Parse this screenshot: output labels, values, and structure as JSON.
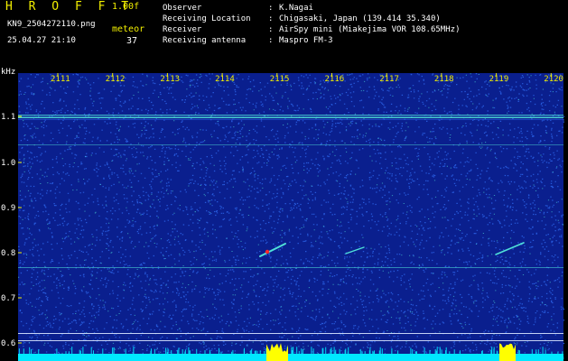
{
  "header": {
    "app_title": "H R O F F T",
    "version": "1.00f",
    "filename": "KN9_2504272110.png",
    "mode": "meteor",
    "datetime": "25.04.27 21:10",
    "count": "37"
  },
  "info": [
    {
      "key": "Observer",
      "value": "K.Nagai"
    },
    {
      "key": "Receiving Location",
      "value": "Chigasaki, Japan (139.414 35.340)"
    },
    {
      "key": "Receiver",
      "value": "AirSpy mini (Miakejima VOR 108.65MHz)"
    },
    {
      "key": "Receiving antenna",
      "value": "Maspro FM-3"
    }
  ],
  "spectrogram": {
    "y_unit": "kHz",
    "x_ticks": [
      "2111",
      "2112",
      "2113",
      "2114",
      "2115",
      "2116",
      "2117",
      "2118",
      "2119",
      "2120"
    ],
    "y_ticks": [
      "1.1",
      "1.0",
      "0.9",
      "0.8",
      "0.7",
      "0.6"
    ],
    "colors": {
      "background": "#0a1f8e",
      "noise": "#2b63e8",
      "signal": "#4fe0d8",
      "peak": "#ff2a2a",
      "label": "#f2ef00",
      "activity": "#00e8ff",
      "spike": "#ffff00"
    }
  }
}
